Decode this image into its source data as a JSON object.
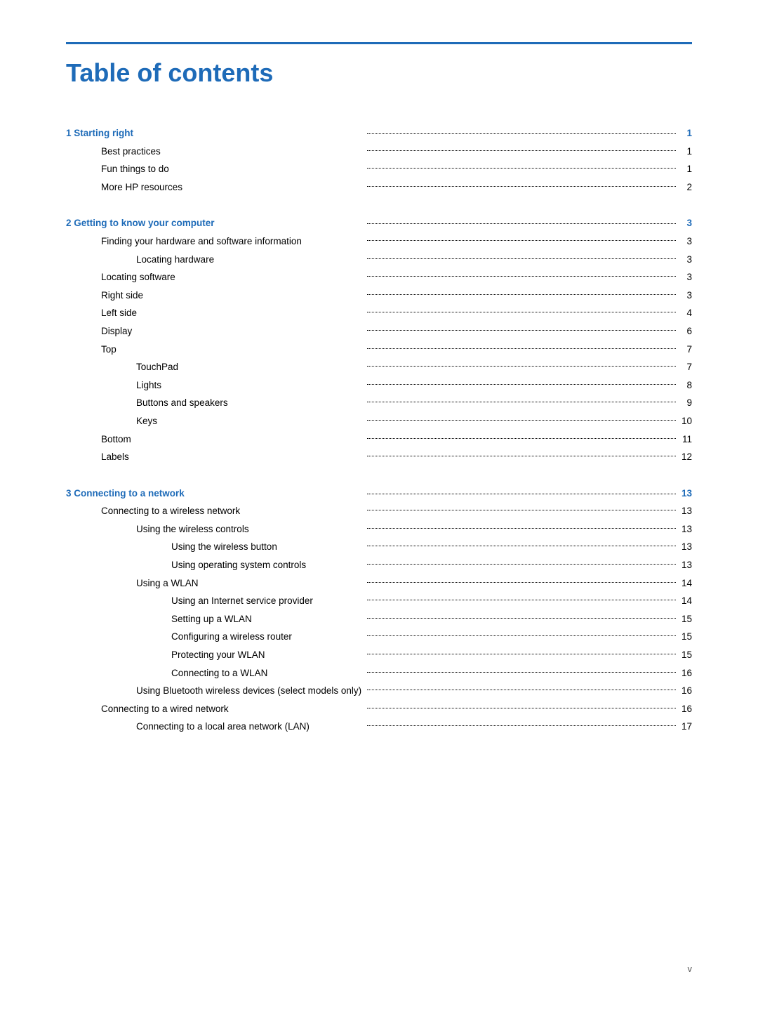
{
  "page": {
    "title": "Table of contents",
    "footer_page": "v"
  },
  "sections": [
    {
      "type": "section-header",
      "indent": 0,
      "label": "1  Starting right",
      "page": "1"
    },
    {
      "type": "entry",
      "indent": 1,
      "label": "Best practices",
      "page": "1"
    },
    {
      "type": "entry",
      "indent": 1,
      "label": "Fun things to do",
      "page": "1"
    },
    {
      "type": "entry",
      "indent": 1,
      "label": "More HP resources",
      "page": "2"
    },
    {
      "type": "spacer"
    },
    {
      "type": "section-header",
      "indent": 0,
      "label": "2  Getting to know your computer",
      "page": "3"
    },
    {
      "type": "entry",
      "indent": 1,
      "label": "Finding your hardware and software information",
      "page": "3"
    },
    {
      "type": "entry",
      "indent": 2,
      "label": "Locating hardware",
      "page": "3"
    },
    {
      "type": "entry",
      "indent": 1,
      "label": "Locating software",
      "page": "3"
    },
    {
      "type": "entry",
      "indent": 1,
      "label": "Right side",
      "page": "3"
    },
    {
      "type": "entry",
      "indent": 1,
      "label": "Left side",
      "page": "4"
    },
    {
      "type": "entry",
      "indent": 1,
      "label": "Display",
      "page": "6"
    },
    {
      "type": "entry",
      "indent": 1,
      "label": "Top",
      "page": "7"
    },
    {
      "type": "entry",
      "indent": 2,
      "label": "TouchPad",
      "page": "7"
    },
    {
      "type": "entry",
      "indent": 2,
      "label": "Lights",
      "page": "8"
    },
    {
      "type": "entry",
      "indent": 2,
      "label": "Buttons and speakers",
      "page": "9"
    },
    {
      "type": "entry",
      "indent": 2,
      "label": "Keys",
      "page": "10"
    },
    {
      "type": "entry",
      "indent": 1,
      "label": "Bottom",
      "page": "11"
    },
    {
      "type": "entry",
      "indent": 1,
      "label": "Labels",
      "page": "12"
    },
    {
      "type": "spacer"
    },
    {
      "type": "section-header",
      "indent": 0,
      "label": "3  Connecting to a network",
      "page": "13"
    },
    {
      "type": "entry",
      "indent": 1,
      "label": "Connecting to a wireless network",
      "page": "13"
    },
    {
      "type": "entry",
      "indent": 2,
      "label": "Using the wireless controls",
      "page": "13"
    },
    {
      "type": "entry",
      "indent": 3,
      "label": "Using the wireless button",
      "page": "13"
    },
    {
      "type": "entry",
      "indent": 3,
      "label": "Using operating system controls",
      "page": "13"
    },
    {
      "type": "entry",
      "indent": 2,
      "label": "Using a WLAN",
      "page": "14"
    },
    {
      "type": "entry",
      "indent": 3,
      "label": "Using an Internet service provider",
      "page": "14"
    },
    {
      "type": "entry",
      "indent": 3,
      "label": "Setting up a WLAN",
      "page": "15"
    },
    {
      "type": "entry",
      "indent": 3,
      "label": "Configuring a wireless router",
      "page": "15"
    },
    {
      "type": "entry",
      "indent": 3,
      "label": "Protecting your WLAN",
      "page": "15"
    },
    {
      "type": "entry",
      "indent": 3,
      "label": "Connecting to a WLAN",
      "page": "16"
    },
    {
      "type": "entry",
      "indent": 2,
      "label": "Using Bluetooth wireless devices (select models only)",
      "page": "16"
    },
    {
      "type": "entry",
      "indent": 1,
      "label": "Connecting to a wired network",
      "page": "16"
    },
    {
      "type": "entry",
      "indent": 2,
      "label": "Connecting to a local area network (LAN)",
      "page": "17"
    }
  ]
}
